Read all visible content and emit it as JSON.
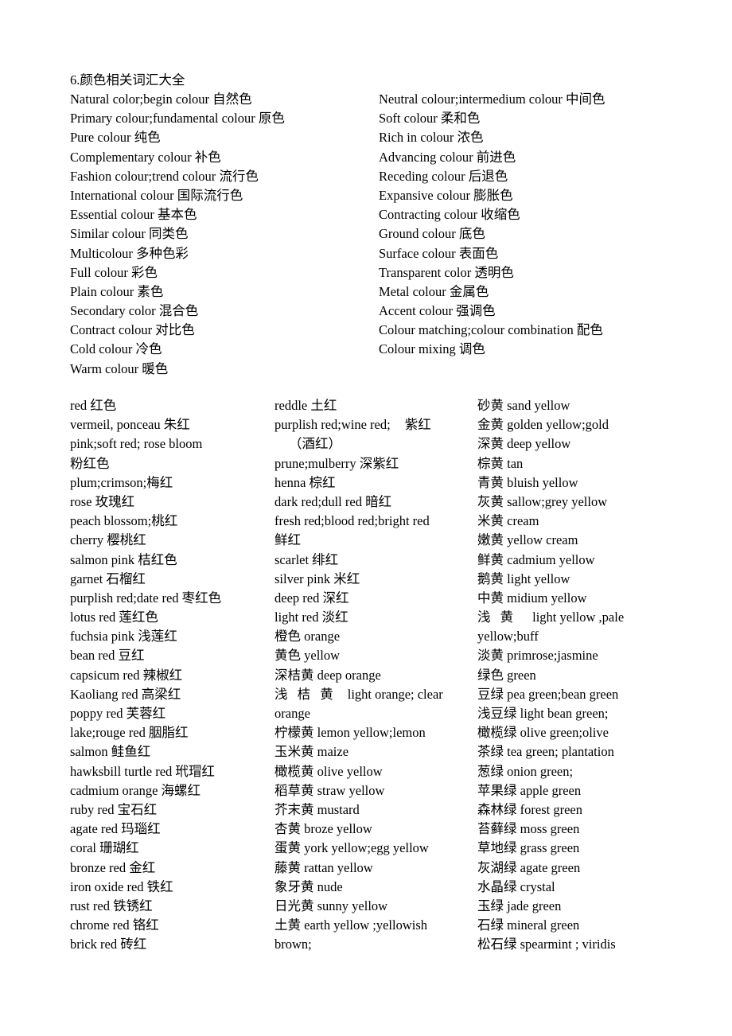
{
  "document": {
    "title": "6.颜色相关词汇大全"
  },
  "section_general": {
    "left_column": [
      "Natural color;begin colour  自然色",
      "Primary colour;fundamental colour  原色",
      "Pure colour  纯色",
      "Complementary colour  补色",
      "Fashion colour;trend colour  流行色",
      "International colour  国际流行色",
      "Essential colour  基本色",
      "Similar colour  同类色",
      "Multicolour  多种色彩",
      "Full colour  彩色",
      "Plain colour  素色",
      "Secondary color  混合色",
      "Contract colour  对比色",
      "Cold colour  冷色",
      "Warm colour  暖色"
    ],
    "right_column": [
      "Neutral colour;intermedium colour  中间色",
      "Soft colour  柔和色",
      "Rich in colour  浓色",
      "Advancing colour  前进色",
      "Receding colour  后退色",
      "Expansive colour  膨胀色",
      "Contracting colour  收缩色",
      "Ground colour  底色",
      "Surface colour  表面色",
      "Transparent color  透明色",
      "Metal colour  金属色",
      "Accent colour  强调色",
      "Colour matching;colour combination  配色",
      "Colour mixing  调色"
    ]
  },
  "section_colors": {
    "column_1": [
      "red  红色",
      "vermeil, ponceau  朱红",
      "pink;soft red; rose bloom",
      "粉红色",
      "plum;crimson;梅红",
      "rose  玫瑰红",
      "peach blossom;桃红",
      "cherry  樱桃红",
      "salmon pink  桔红色",
      "garnet 石榴红",
      "purplish red;date red  枣红色",
      "lotus red  莲红色",
      "fuchsia pink  浅莲红",
      "bean red  豆红",
      "capsicum red 辣椒红",
      "Kaoliang red  高梁红",
      "poppy red  芙蓉红",
      "lake;rouge red 胭脂红",
      "salmon  鲑鱼红",
      "hawksbill turtle red  玳瑁红",
      "cadmium orange  海螺红",
      "ruby red  宝石红",
      "agate red  玛瑙红",
      "coral 珊瑚红",
      "bronze red 金红",
      "iron oxide red 铁红",
      "rust red 铁锈红",
      "chrome red 铬红",
      "brick red 砖红"
    ],
    "column_2": [
      "reddle  土红",
      "purplish red;wine red;",
      "紫红",
      "（酒红）",
      "prune;mulberry 深紫红",
      "henna 棕红",
      "dark red;dull red 暗红",
      "fresh red;blood red;bright red",
      "鲜红",
      "scarlet 绯红",
      "silver pink 米红",
      "deep red 深红",
      "light red  淡红",
      "橙色  orange",
      "黄色  yellow",
      "深桔黄  deep orange",
      "浅 桔 黄",
      "light  orange; clear",
      "orange",
      "柠檬黄  lemon yellow;lemon",
      "玉米黄  maize",
      "橄榄黄  olive yellow",
      "稻草黄  straw yellow",
      "芥末黄  mustard",
      "杏黄  broze yellow",
      "蛋黄  york yellow;egg yellow",
      "藤黄  rattan yellow",
      "象牙黄  nude",
      "日光黄  sunny yellow",
      "土黄  earth yellow ;yellowish",
      "brown;"
    ],
    "column_3": [
      "砂黄  sand yellow",
      "金黄  golden yellow;gold",
      "深黄  deep yellow",
      "棕黄  tan",
      "青黄  bluish yellow",
      "灰黄  sallow;grey yellow",
      "米黄  cream",
      "嫩黄  yellow cream",
      "鲜黄  cadmium yellow",
      "鹅黄  light yellow",
      "中黄  midium yellow",
      "浅 黄",
      "light  yellow  ,pale",
      "yellow;buff",
      "淡黄  primrose;jasmine",
      "绿色  green",
      "豆绿  pea green;bean green",
      "浅豆绿  light bean green;",
      "橄榄绿  olive green;olive",
      "茶绿  tea green; plantation",
      "葱绿  onion green;",
      "苹果绿  apple green",
      "森林绿  forest green",
      "苔藓绿  moss green",
      "草地绿  grass green",
      "灰湖绿  agate green",
      "水晶绿  crystal",
      "玉绿  jade green",
      "石绿  mineral green",
      "松石绿  spearmint ; viridis"
    ]
  }
}
